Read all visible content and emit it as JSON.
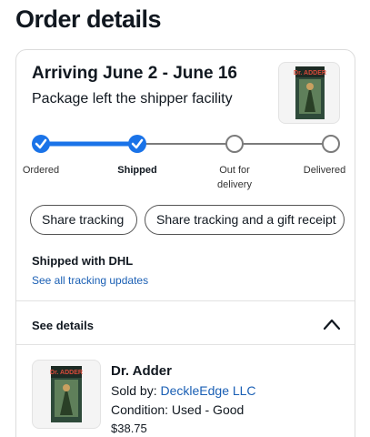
{
  "page_title": "Order details",
  "shipment": {
    "arrival": "Arriving June 2 - June 16",
    "status": "Package left the shipper facility",
    "tracker": {
      "steps": [
        {
          "label": "Ordered",
          "state": "complete"
        },
        {
          "label": "Shipped",
          "state": "complete"
        },
        {
          "label": "Out for delivery",
          "state": "pending"
        },
        {
          "label": "Delivered",
          "state": "pending"
        }
      ],
      "complete_color": "#1a73e8",
      "pending_color": "#7b7b7b"
    },
    "buttons": {
      "share_tracking": "Share tracking",
      "share_gift": "Share tracking and a gift receipt"
    },
    "carrier": "Shipped with DHL",
    "tracking_link": "See all tracking updates"
  },
  "details": {
    "header": "See details",
    "expanded": true
  },
  "item": {
    "title": "Dr. Adder",
    "sold_by_label": "Sold by: ",
    "seller": "DeckleEdge LLC",
    "condition": "Condition: Used - Good",
    "price": "$38.75",
    "cover_text": "Dr. ADDER"
  },
  "colors": {
    "link": "#1a5fb4",
    "text": "#111820",
    "accent": "#1a73e8"
  }
}
